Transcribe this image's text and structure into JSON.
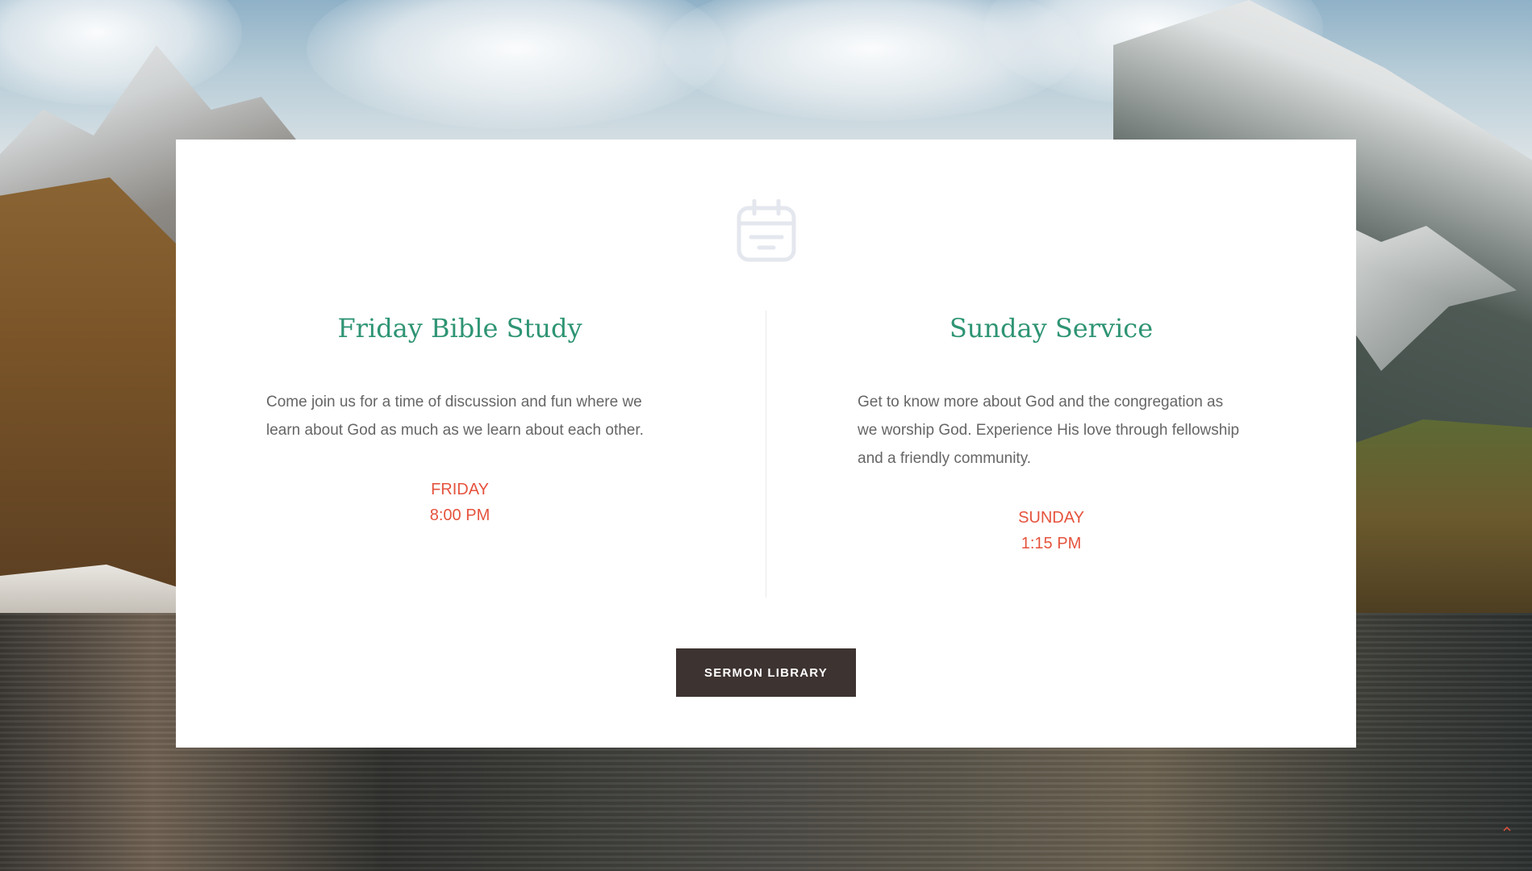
{
  "events": [
    {
      "title": "Friday Bible Study",
      "description": "Come join us for a time of discussion and fun where we learn about God as much as we learn about each other.",
      "day": "FRIDAY",
      "time": "8:00 PM"
    },
    {
      "title": "Sunday Service",
      "description": "Get to know more about God and the congregation as we worship God.  Experience His love through fellowship and a friendly community.",
      "day": "SUNDAY",
      "time": "1:15 PM"
    }
  ],
  "sermon_button": {
    "label": "SERMON LIBRARY"
  },
  "icons": {
    "header": "calendar-icon",
    "corner": "chevron-up-icon"
  },
  "colors": {
    "title": "#2e9474",
    "schedule": "#e5533d",
    "button_bg": "#3d3331",
    "body_text": "#666666",
    "card_bg": "#ffffff"
  }
}
